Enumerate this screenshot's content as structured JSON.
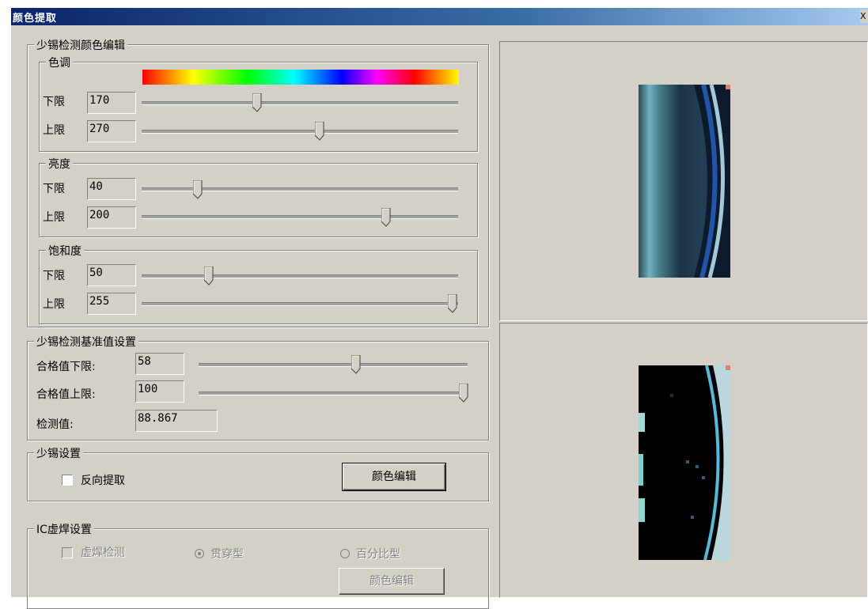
{
  "window": {
    "title": "颜色提取",
    "close_label": "X"
  },
  "editor": {
    "legend": "少锡检测颜色编辑",
    "hue": {
      "legend": "色调",
      "lower_label": "下限",
      "lower_value": "170",
      "upper_label": "上限",
      "upper_value": "270"
    },
    "brightness": {
      "legend": "亮度",
      "lower_label": "下限",
      "lower_value": "40",
      "upper_label": "上限",
      "upper_value": "200"
    },
    "saturation": {
      "legend": "饱和度",
      "lower_label": "下限",
      "lower_value": "50",
      "upper_label": "上限",
      "upper_value": "255"
    }
  },
  "baseline": {
    "legend": "少锡检测基准值设置",
    "pass_lower_label": "合格值下限:",
    "pass_lower_value": "58",
    "pass_upper_label": "合格值上限:",
    "pass_upper_value": "100",
    "measured_label": "检测值:",
    "measured_value": "88.867"
  },
  "tin_settings": {
    "legend": "少锡设置",
    "reverse_label": "反向提取",
    "reverse_checked": false,
    "color_edit_label": "颜色编辑"
  },
  "ic_settings": {
    "legend": "IC虚焊设置",
    "detect_label": "虚焊检测",
    "through_label": "贯穿型",
    "percent_label": "百分比型",
    "color_edit_label": "颜色编辑"
  },
  "colors": {
    "dialog_bg": "#d4d0c8",
    "title_start": "#0a246a",
    "title_end": "#a6caf0"
  }
}
